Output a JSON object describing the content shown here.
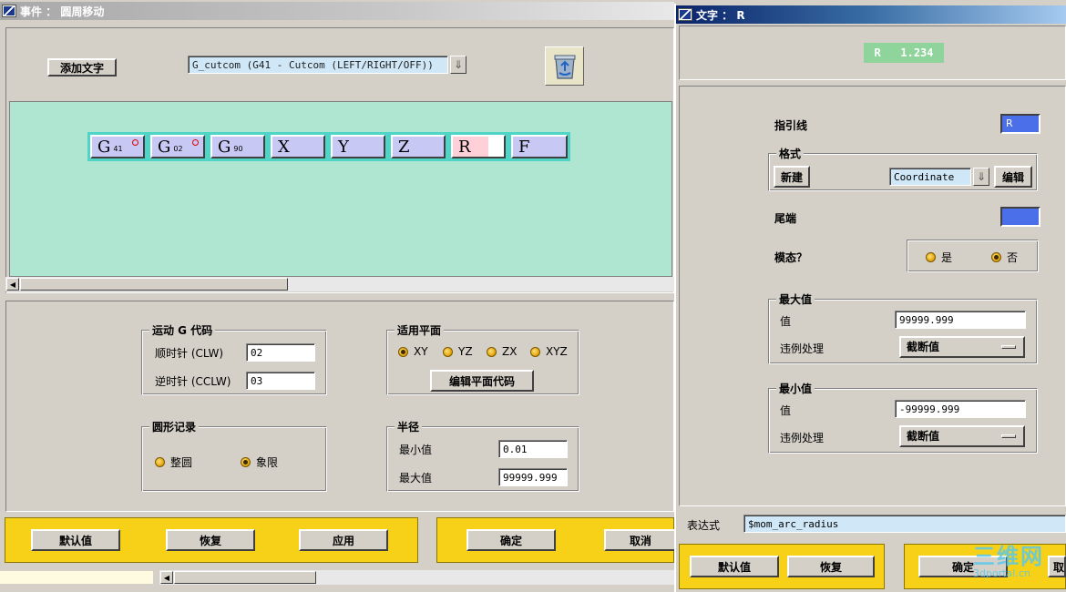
{
  "left_window": {
    "title": "事件 ： 圆周移动",
    "add_text_label": "添加文字",
    "format_combo_value": "G_cutcom (G41 - Cutcom (LEFT/RIGHT/OFF))",
    "trash_icon": "recycle-bin-icon",
    "blocks": [
      {
        "letter": "G",
        "sub": "41",
        "dot": true
      },
      {
        "letter": "G",
        "sub": "02",
        "dot": true
      },
      {
        "letter": "G",
        "sub": "90",
        "dot": false
      },
      {
        "letter": "X",
        "sub": "",
        "dot": false
      },
      {
        "letter": "Y",
        "sub": "",
        "dot": false
      },
      {
        "letter": "Z",
        "sub": "",
        "dot": false
      },
      {
        "letter": "R",
        "sub": "",
        "dot": false
      },
      {
        "letter": "F",
        "sub": "",
        "dot": false
      }
    ],
    "motion_group": {
      "title": "运动 G 代码",
      "clw_label": "顺时针 (CLW)",
      "clw_value": "02",
      "cclw_label": "逆时针 (CCLW)",
      "cclw_value": "03"
    },
    "plane_group": {
      "title": "适用平面",
      "options": [
        "XY",
        "YZ",
        "ZX",
        "XYZ"
      ],
      "selected": "XY",
      "edit_button": "编辑平面代码"
    },
    "circle_group": {
      "title": "圆形记录",
      "options": [
        "整圆",
        "象限"
      ],
      "selected": "象限"
    },
    "radius_group": {
      "title": "半径",
      "min_label": "最小值",
      "min_value": "0.01",
      "max_label": "最大值",
      "max_value": "99999.999"
    },
    "buttons": {
      "default": "默认值",
      "restore": "恢复",
      "apply": "应用",
      "ok": "确定",
      "cancel": "取消"
    }
  },
  "right_window": {
    "title": "文字 ： R",
    "preview": "R   1.234",
    "leader_label": "指引线",
    "leader_value": "R",
    "format_group": {
      "title": "格式",
      "new_button": "新建",
      "combo_value": "Coordinate",
      "edit_button": "编辑"
    },
    "trailer_label": "尾端",
    "modal_label": "模态？",
    "modal_options": [
      "是",
      "否"
    ],
    "modal_selected": "否",
    "max_group": {
      "title": "最大值",
      "value_label": "值",
      "value": "99999.999",
      "violation_label": "违例处理",
      "violation_value": "截断值"
    },
    "min_group": {
      "title": "最小值",
      "value_label": "值",
      "value": "-99999.999",
      "violation_label": "违例处理",
      "violation_value": "截断值"
    },
    "expression_label": "表达式",
    "expression_value": "$mom_arc_radius",
    "buttons": {
      "default": "默认值",
      "restore": "恢复",
      "ok": "确定",
      "cancel": "取"
    }
  },
  "watermark": {
    "brand": "三维网",
    "url": "3dportal.cn"
  },
  "colors": {
    "canvas": "#aee6d2",
    "block_frame": "#4fd5c8",
    "block_fill": "#c8c8f4",
    "selected_block": "#ffd0d8",
    "yellow_panel": "#f7d117",
    "preview_bg": "#8fd49a",
    "blue_field": "#4a6fe8"
  }
}
